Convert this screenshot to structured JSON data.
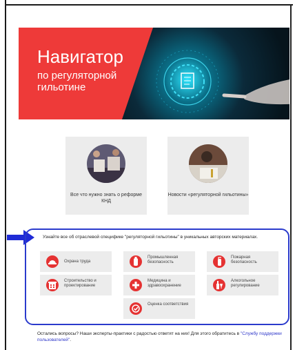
{
  "hero": {
    "title": "Навигатор",
    "subtitle": "по регуляторной гильотине"
  },
  "cards": [
    {
      "label": "Все что нужно знать о реформе КНД"
    },
    {
      "label": "Новости «регуляторной гильотины»"
    }
  ],
  "panel": {
    "intro": "Узнайте все об отраслевой специфике \"регуляторной гильотины\" в уникальных авторских материалах.",
    "tiles": [
      {
        "label": "Охрана труда"
      },
      {
        "label": "Промышленная безопасность"
      },
      {
        "label": "Пожарная безопасность"
      },
      {
        "label": "Строительство и проектирование"
      },
      {
        "label": "Медицина и здравоохранение"
      },
      {
        "label": "Алкогольное регулирование"
      },
      {
        "label": "Оценка соответствия"
      }
    ]
  },
  "footer": {
    "text": "Остались вопросы? Наши эксперты-практики с радостью ответят на них! Для этого обратитесь в",
    "link": "\"Службу поддержки пользователей\"",
    "end": "."
  },
  "colors": {
    "accent": "#ee3a39",
    "highlight_border": "#2a3acc",
    "arrow": "#1f2bd6"
  }
}
